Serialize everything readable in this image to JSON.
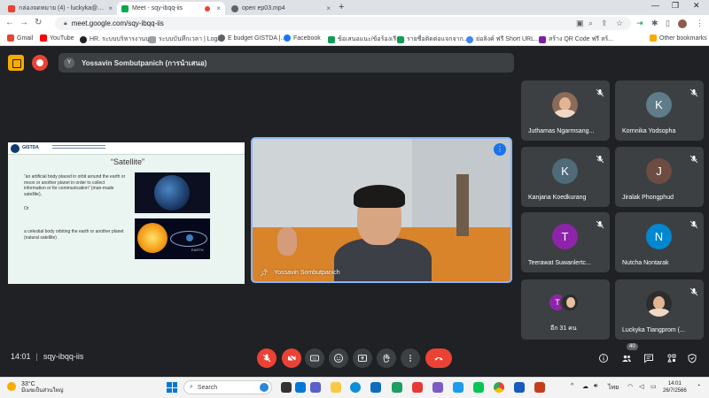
{
  "browser": {
    "tabs": [
      {
        "title": "กล่องจดหมาย (4) - luckyka@gistda.or.th"
      },
      {
        "title": "Meet - sqy-ibqq-iis"
      },
      {
        "title": "open ep03.mp4"
      }
    ],
    "new_tab": "+",
    "address": "meet.google.com/sqy-ibqq-iis",
    "bookmarks": [
      {
        "label": "Gmail",
        "color": "#ea4335"
      },
      {
        "label": "YouTube",
        "color": "#ff0000"
      },
      {
        "label": "HR. ระบบบริหารงานบุ...",
        "color": "#202124"
      },
      {
        "label": "ระบบบันทึกเวลา | Login",
        "color": "#9aa0a6"
      },
      {
        "label": "E budget GISTDA |...",
        "color": "#5f6368"
      },
      {
        "label": "Facebook",
        "color": "#1877f2"
      },
      {
        "label": "ข้อเสนอแนะ/ข้อร้องเรีย...",
        "color": "#0f9d58"
      },
      {
        "label": "รายชื่อติดต่อแจกจาก...",
        "color": "#0f9d58"
      },
      {
        "label": "ย่อลิงค์ ฟรี Short URL...",
        "color": "#4285f4"
      },
      {
        "label": "สร้าง QR Code ฟรี สร้...",
        "color": "#7b1fa2"
      }
    ],
    "other_bookmarks": "Other bookmarks"
  },
  "meet": {
    "presenter_initial": "Y",
    "presenter_label": "Yossavin Sombutpanich (การนำเสนอ)",
    "slide": {
      "title": "“Satellite”",
      "definition1": "“an artificial body placed in orbit around the earth or moon or another planet in order to collect information or for communication” (man-made satellite),",
      "or": "Or",
      "definition2": "a celestial body orbiting the earth or another planet (natural satellite)",
      "org": "GISTDA",
      "earth_caption": "EARTH"
    },
    "main_video": {
      "name": "Yossavin Sombutpanich",
      "menu": "⋮"
    },
    "participants": [
      {
        "name": "Juthamas Ngarmsang...",
        "initial": "",
        "color": "#8a6a58",
        "photo": true
      },
      {
        "name": "Kornnika Yodsopha",
        "initial": "K",
        "color": "#5f7c8a",
        "photo": false
      },
      {
        "name": "Kanjana Koedkurang",
        "initial": "K",
        "color": "#4f6a78",
        "photo": false
      },
      {
        "name": "Jiralak Phongphud",
        "initial": "J",
        "color": "#6d4c41",
        "photo": false
      },
      {
        "name": "Teerawat Suwanlertc...",
        "initial": "T",
        "color": "#8e24aa",
        "photo": false
      },
      {
        "name": "Nutcha Nontarak",
        "initial": "N",
        "color": "#0288d1",
        "photo": false
      },
      {
        "name": "Luckyka Tiangprom (...",
        "initial": "",
        "color": "#2d2d2d",
        "photo": true
      }
    ],
    "others_label": "อีก 31 คน",
    "others_initial": "T",
    "time": "14:01",
    "separator": "|",
    "meeting_code": "sqy-ibqq-iis",
    "participant_count": "40"
  },
  "taskbar": {
    "weather_temp": "33°C",
    "weather_desc": "มีเมฆเป็นส่วนใหญ่",
    "search_label": "Search",
    "lang": "ไทย",
    "clock_time": "14:01",
    "clock_date": "26/7/2566"
  }
}
